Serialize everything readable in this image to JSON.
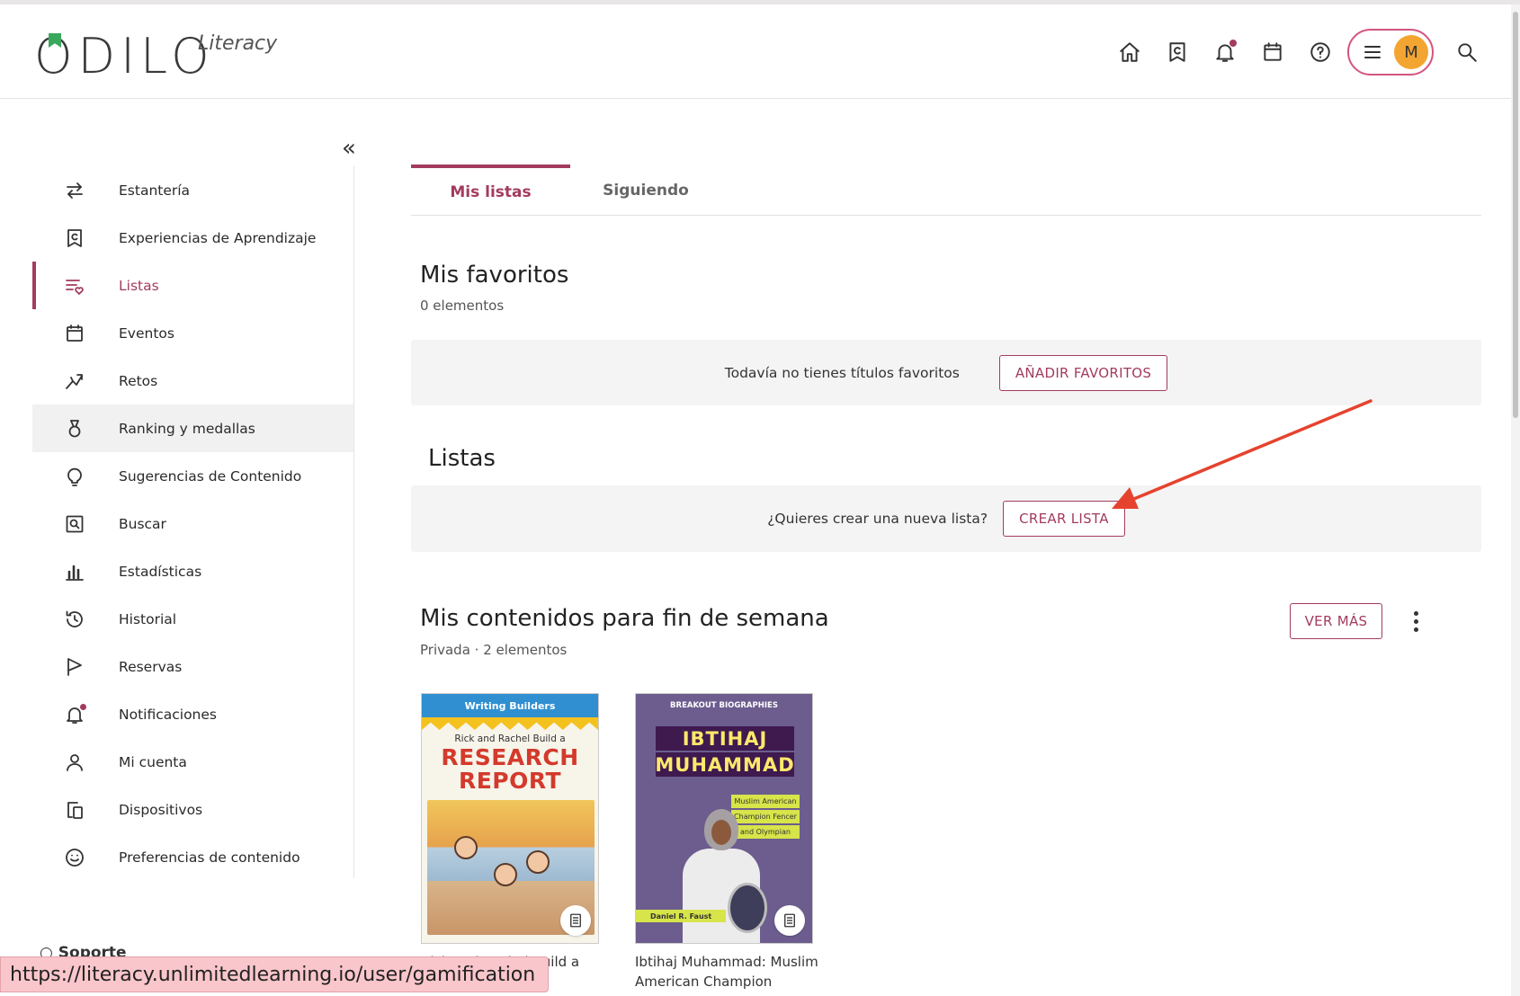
{
  "header": {
    "logo_word": "ODILO",
    "logo_sub": "Literacy",
    "avatar_initial": "M"
  },
  "sidebar": {
    "items": [
      {
        "label": "Estantería",
        "icon": "swap-icon"
      },
      {
        "label": "Experiencias de Aprendizaje",
        "icon": "bookmark-c-icon"
      },
      {
        "label": "Listas",
        "icon": "list-heart-icon"
      },
      {
        "label": "Eventos",
        "icon": "calendar-icon"
      },
      {
        "label": "Retos",
        "icon": "challenge-icon"
      },
      {
        "label": "Ranking y medallas",
        "icon": "medal-icon"
      },
      {
        "label": "Sugerencias de Contenido",
        "icon": "lightbulb-icon"
      },
      {
        "label": "Buscar",
        "icon": "search-box-icon"
      },
      {
        "label": "Estadísticas",
        "icon": "bar-chart-icon"
      },
      {
        "label": "Historial",
        "icon": "history-icon"
      },
      {
        "label": "Reservas",
        "icon": "flag-icon"
      },
      {
        "label": "Notificaciones",
        "icon": "bell-icon"
      },
      {
        "label": "Mi cuenta",
        "icon": "user-icon"
      },
      {
        "label": "Dispositivos",
        "icon": "devices-icon"
      },
      {
        "label": "Preferencias de contenido",
        "icon": "smile-icon"
      }
    ],
    "support_label": "Soporte"
  },
  "tabs": {
    "active": "Mis listas",
    "inactive": "Siguiendo"
  },
  "favorites": {
    "title": "Mis favoritos",
    "count": "0 elementos",
    "empty_text": "Todavía no tienes títulos favoritos",
    "button": "AÑADIR FAVORITOS"
  },
  "lists": {
    "title": "Listas",
    "prompt": "¿Quieres crear una nueva lista?",
    "button": "CREAR LISTA"
  },
  "weekend_list": {
    "title": "Mis contenidos para fin de semana",
    "meta": "Privada · 2 elementos",
    "button": "VER MÁS",
    "books": [
      {
        "series": "Writing Builders",
        "subtitle": "Rick and Rachel Build a",
        "title_line1": "RESEARCH",
        "title_line2": "REPORT",
        "caption": "Rick and Rachel Build a"
      },
      {
        "series": "BREAKOUT BIOGRAPHIES",
        "title_line1": "IBTIHAJ",
        "title_line2": "MUHAMMAD",
        "tag1": "Muslim American",
        "tag2": "Champion Fencer",
        "tag3": "and Olympian",
        "author": "Daniel R. Faust",
        "caption": "Ibtihaj Muhammad: Muslim American Champion"
      }
    ]
  },
  "status_url": "https://literacy.unlimitedlearning.io/user/gamification",
  "colors": {
    "accent": "#a33b5e",
    "pill_border": "#d4547f",
    "avatar": "#f3a531",
    "panel_bg": "#f4f4f4",
    "annotation_arrow": "#e5432e"
  }
}
